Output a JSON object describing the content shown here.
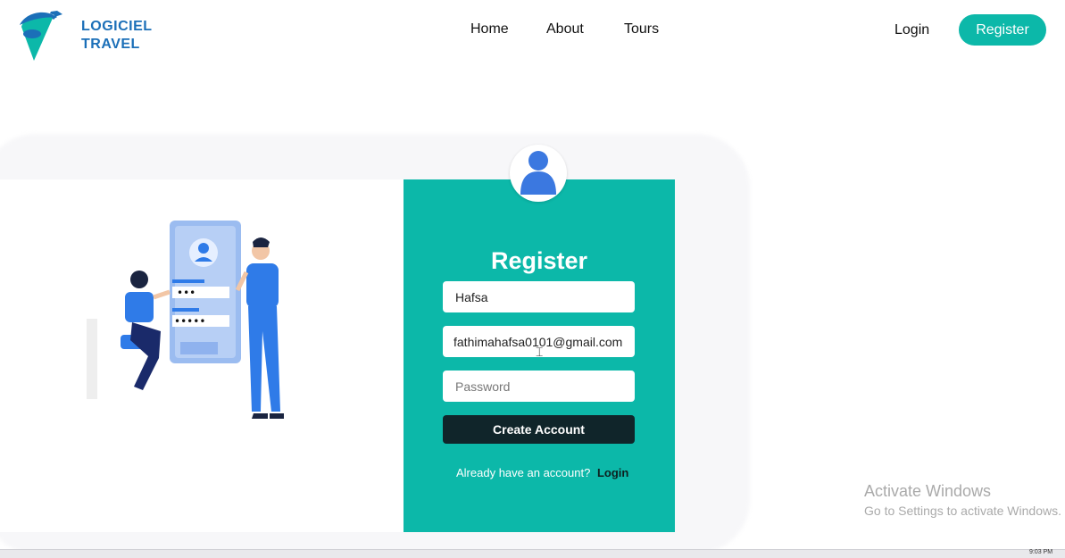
{
  "brand": {
    "line1": "LOGICIEL",
    "line2": "TRAVEL"
  },
  "nav": {
    "items": [
      "Home",
      "About",
      "Tours"
    ],
    "login": "Login",
    "register": "Register"
  },
  "form": {
    "title": "Register",
    "name_value": "Hafsa",
    "email_value": "fathimahafsa0101@gmail.com",
    "password_placeholder": "Password",
    "submit_label": "Create Account",
    "already_text": "Already have an account?",
    "login_link": "Login"
  },
  "watermark": {
    "title": "Activate Windows",
    "subtitle": "Go to Settings to activate Windows."
  },
  "taskbar": {
    "clock": "9:03 PM"
  },
  "colors": {
    "accent": "#0cb8a9",
    "button_dark": "#10252a",
    "brand_blue": "#1b6fb8"
  },
  "icons": [
    "logo-plane-icon",
    "user-avatar-icon",
    "text-cursor-icon"
  ]
}
